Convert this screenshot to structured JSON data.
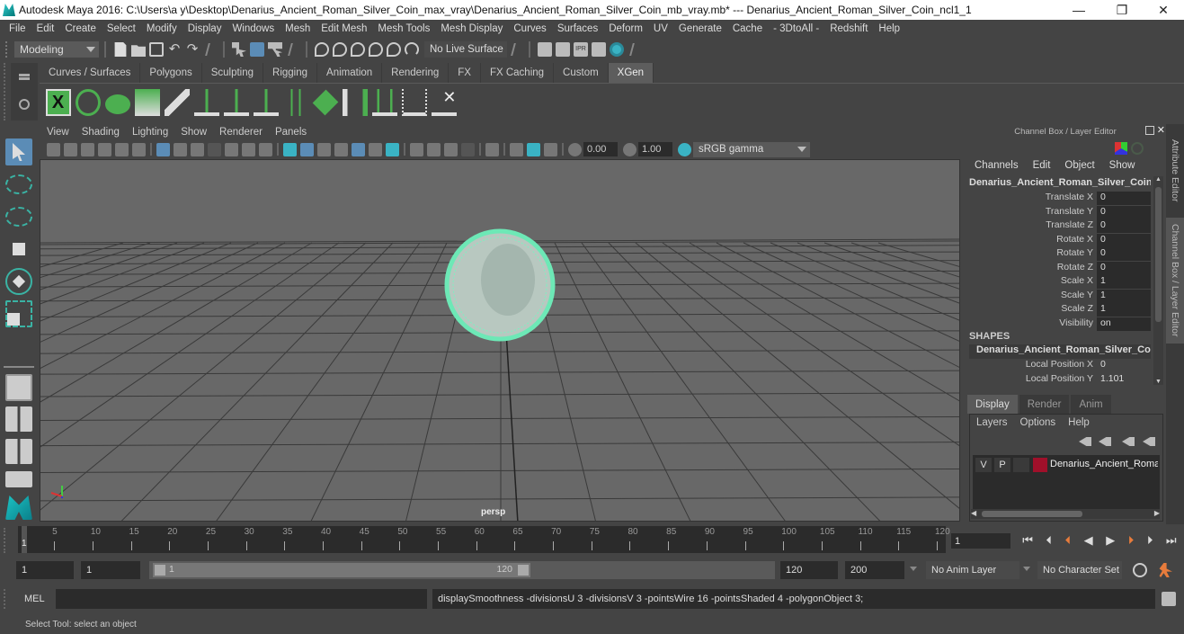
{
  "titlebar": {
    "title": "Autodesk Maya 2016: C:\\Users\\a y\\Desktop\\Denarius_Ancient_Roman_Silver_Coin_max_vray\\Denarius_Ancient_Roman_Silver_Coin_mb_vray.mb*  ---  Denarius_Ancient_Roman_Silver_Coin_ncl1_1",
    "minimize": "—",
    "restore": "❐",
    "close": "✕"
  },
  "menubar": [
    "File",
    "Edit",
    "Create",
    "Select",
    "Modify",
    "Display",
    "Windows",
    "Mesh",
    "Edit Mesh",
    "Mesh Tools",
    "Mesh Display",
    "Curves",
    "Surfaces",
    "Deform",
    "UV",
    "Generate",
    "Cache",
    "- 3DtoAll -",
    "Redshift",
    "Help"
  ],
  "statusline": {
    "mode": "Modeling",
    "live_surface": "No Live Surface"
  },
  "shelf": {
    "tabs": [
      "Curves / Surfaces",
      "Polygons",
      "Sculpting",
      "Rigging",
      "Animation",
      "Rendering",
      "FX",
      "FX Caching",
      "Custom",
      "XGen"
    ],
    "active_tab": "XGen",
    "icons": [
      "xgen-editor-icon",
      "xgen-preview-icon",
      "xgen-clear-icon",
      "create-description-icon",
      "move-guides-icon",
      "add-guide-icon",
      "sculpt-guide-icon",
      "lock-guide-icon",
      "guides-to-curves-icon",
      "patches-icon",
      "rebuild-guides-icon",
      "select-guides-icon",
      "select-all-guides-icon",
      "delete-guides-icon"
    ]
  },
  "panel": {
    "menu": [
      "View",
      "Shading",
      "Lighting",
      "Show",
      "Renderer",
      "Panels"
    ],
    "exposure": "0.00",
    "gamma": "1.00",
    "colorspace": "sRGB gamma",
    "camera_label": "persp"
  },
  "channelbox": {
    "header": "Channel Box / Layer Editor",
    "menu": [
      "Channels",
      "Edit",
      "Object",
      "Show"
    ],
    "object_name": "Denarius_Ancient_Roman_Silver_Coin...",
    "channels": [
      {
        "label": "Translate X",
        "value": "0"
      },
      {
        "label": "Translate Y",
        "value": "0"
      },
      {
        "label": "Translate Z",
        "value": "0"
      },
      {
        "label": "Rotate X",
        "value": "0"
      },
      {
        "label": "Rotate Y",
        "value": "0"
      },
      {
        "label": "Rotate Z",
        "value": "0"
      },
      {
        "label": "Scale X",
        "value": "1"
      },
      {
        "label": "Scale Y",
        "value": "1"
      },
      {
        "label": "Scale Z",
        "value": "1"
      },
      {
        "label": "Visibility",
        "value": "on"
      }
    ],
    "shapes_label": "SHAPES",
    "shape_name": "Denarius_Ancient_Roman_Silver_Coi...",
    "shape_channels": [
      {
        "label": "Local Position X",
        "value": "0"
      },
      {
        "label": "Local Position Y",
        "value": "1.101"
      }
    ]
  },
  "sidetabs": [
    "Attribute Editor",
    "Channel Box / Layer Editor"
  ],
  "layereditor": {
    "tabs": [
      "Display",
      "Render",
      "Anim"
    ],
    "active_tab": "Display",
    "menu": [
      "Layers",
      "Options",
      "Help"
    ],
    "layer": {
      "v": "V",
      "p": "P",
      "color": "#a0102a",
      "name": "Denarius_Ancient_Roman_Silver_Coin"
    }
  },
  "timeline": {
    "ticks": [
      1,
      5,
      10,
      15,
      20,
      25,
      30,
      35,
      40,
      45,
      50,
      55,
      60,
      65,
      70,
      75,
      80,
      85,
      90,
      95,
      100,
      105,
      110,
      115,
      120
    ],
    "start": 1,
    "end": 120,
    "current_frame": "1"
  },
  "range": {
    "start_time": "1",
    "playback_start": "1",
    "range_start_label": "1",
    "range_end_label": "120",
    "playback_end": "120",
    "end_time": "200",
    "anim_layer": "No Anim Layer",
    "character_set": "No Character Set"
  },
  "commandline": {
    "label": "MEL",
    "input": "",
    "result": "displaySmoothness -divisionsU 3 -divisionsV 3 -pointsWire 16 -pointsShaded 4 -polygonObject 3;"
  },
  "helpline": "Select Tool: select an object"
}
